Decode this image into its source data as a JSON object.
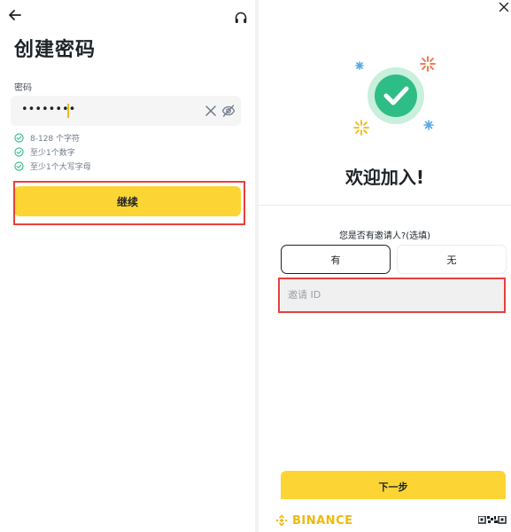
{
  "left_panel": {
    "title": "创建密码",
    "password": {
      "label": "密码",
      "masked_value": "••••••••"
    },
    "requirements": [
      {
        "text": "8-128 个字符",
        "met": true
      },
      {
        "text": "至少1个数字",
        "met": true
      },
      {
        "text": "至少1个大写字母",
        "met": true
      }
    ],
    "continue_label": "继续"
  },
  "right_panel": {
    "welcome_title": "欢迎加入!",
    "referrer_question": "您是否有邀请人?(选填)",
    "choices": {
      "yes": "有",
      "no": "无"
    },
    "invite_placeholder": "邀请 ID",
    "next_label": "下一步",
    "brand": "BINANCE"
  },
  "colors": {
    "accent": "#fcd535",
    "brand": "#f0b90b",
    "success": "#2ebd85",
    "highlight": "#e8403a"
  },
  "icons": [
    "back-arrow-icon",
    "headset-icon",
    "clear-icon",
    "eye-off-icon",
    "check-circle-icon",
    "close-icon",
    "binance-logo-icon",
    "qr-code-icon"
  ]
}
